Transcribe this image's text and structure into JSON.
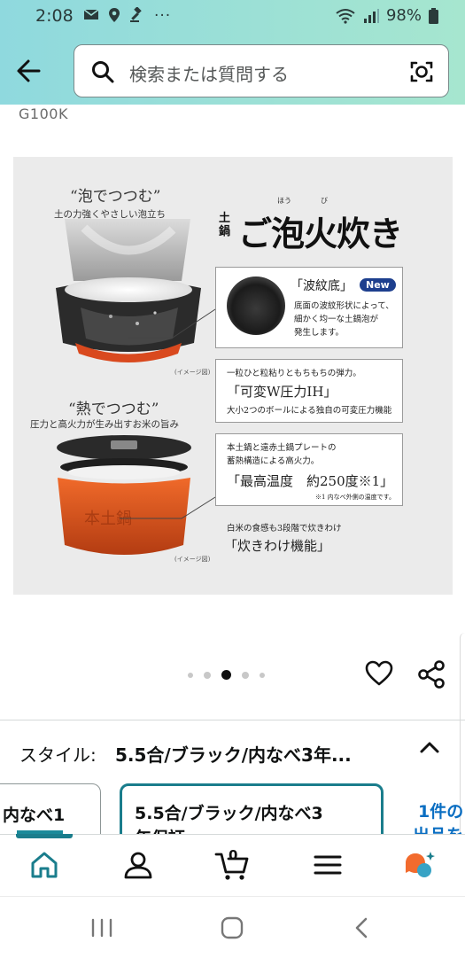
{
  "status_bar": {
    "time": "2:08",
    "notification_icons": [
      "mail-icon",
      "location-icon",
      "gavel-icon",
      "more-icon"
    ],
    "overflow": "···",
    "battery": "98%"
  },
  "header": {
    "search_placeholder": "検索または質問する"
  },
  "product": {
    "model_fragment": "G100K",
    "image_text": {
      "heading1": "“泡でつつむ”",
      "heading1_sub": "土の力強くやさしい泡立ち",
      "brand_prefix": "土鍋",
      "brand": "ご泡火炊き",
      "ruby_ho": "ほう",
      "ruby_bi": "び",
      "feature1_title": "「波紋底」",
      "feature1_badge": "New",
      "feature1_desc_1": "底面の波紋形状によって、",
      "feature1_desc_2": "細かく均一な土鍋泡が",
      "feature1_desc_3": "発生します。",
      "image_note": "(イメージ図)",
      "heading2": "“熱でつつむ”",
      "heading2_sub": "圧力と高火力が生み出すお米の旨み",
      "feature2_pre": "一粒ひと粒粘りともちもちの弾力。",
      "feature2_title": "「可変W圧力IH」",
      "feature2_desc": "大小2つのボールによる独自の可変圧力機能",
      "feature3_pre_1": "本土鍋と遠赤土鍋プレートの",
      "feature3_pre_2": "蓄熱構造による高火力。",
      "feature3_title": "「最高温度　約250度※1」",
      "feature3_note": "※1 内なべ外側の温度です。",
      "feature4_pre": "白米の食感も3段階で炊きわけ",
      "feature4_title": "「炊きわけ機能」"
    },
    "carousel": {
      "total": 5,
      "active_index": 2
    }
  },
  "style_selector": {
    "label": "スタイル:",
    "value": "5.5合/ブラック/内なべ3年...",
    "options": [
      {
        "label": "内なべ1",
        "selected": false
      },
      {
        "label_line1": "5.5合/ブラック/内なべ3",
        "label_line2": "年保証",
        "selected": true
      },
      {
        "label_line1": "1件の",
        "label_line2": "出品を",
        "selected": false
      }
    ]
  },
  "bottom_nav": {
    "items": [
      "home-icon",
      "account-icon",
      "cart-icon",
      "menu-icon",
      "rufus-icon"
    ],
    "cart_count": "0",
    "active": "home-icon"
  },
  "colors": {
    "header_gradient_start": "#8fd9de",
    "header_gradient_end": "#a6e6cf",
    "accent_teal": "#1a7d8c",
    "link_blue": "#0a6ec2",
    "new_badge": "#1d3f8e",
    "rufus_orange": "#f26b2e"
  }
}
